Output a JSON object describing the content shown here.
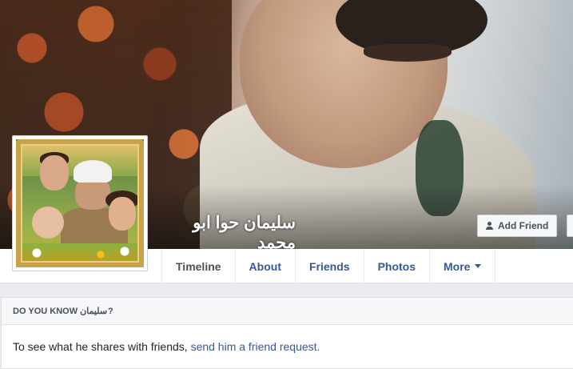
{
  "profile": {
    "name": "سليمان حوا ابو محمد",
    "add_friend_label": "Add Friend"
  },
  "tabs": [
    {
      "label": "Timeline"
    },
    {
      "label": "About"
    },
    {
      "label": "Friends"
    },
    {
      "label": "Photos"
    },
    {
      "label": "More"
    }
  ],
  "do_you_know": {
    "prefix": "DO YOU KNOW",
    "first_name": "سليمان",
    "suffix": "?",
    "body_text": "To see what he shares with friends, ",
    "link_text": "send him a friend request."
  },
  "colors": {
    "link": "#365899",
    "background": "#e9ebee"
  }
}
